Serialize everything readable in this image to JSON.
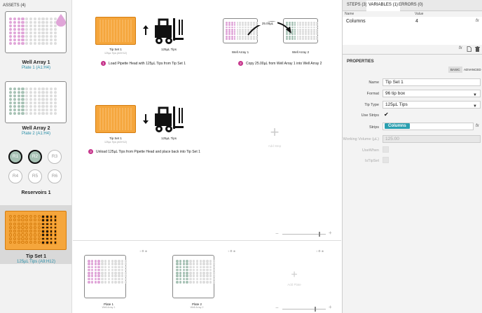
{
  "assets_panel": {
    "header": "ASSETS (4)",
    "assets": [
      {
        "name": "Well Array 1",
        "sub": "Plate 1 (A1:H4)"
      },
      {
        "name": "Well Array 2",
        "sub": "Plate 2 (A1:H4)"
      },
      {
        "name": "Reservoirs 1",
        "sub": ""
      },
      {
        "name": "Tip Set 1",
        "sub": "125µL Tips (A9:H12)"
      }
    ],
    "reservoirs": [
      "R1",
      "R2",
      "R3",
      "R4",
      "R5",
      "R6"
    ]
  },
  "workspace": {
    "steps": [
      {
        "number": "1",
        "text": "Load Pipette Head with 125µL Tips from Tip Set 1",
        "source_label": "Tip Set 1",
        "source_sub": "125µL Tips (A9:H12)",
        "target_label": "125µL Tips"
      },
      {
        "number": "2",
        "text": "Copy 25.00µL from Well Array 1 into Well Array 2",
        "source_label": "Well Array 1",
        "target_label": "Well Array 2",
        "arrow_label": "25.00µL"
      },
      {
        "number": "3",
        "text": "Unload 125µL Tips from Pipette Head and place back into Tip Set 1",
        "source_label": "Tip Set 1",
        "source_sub": "125µL Tips (A9:H12)",
        "target_label": "125µL Tips"
      }
    ],
    "add_step": "Add Step"
  },
  "deck": {
    "plates": [
      {
        "name": "Plate 1",
        "sub": "Well Array 1"
      },
      {
        "name": "Plate 2",
        "sub": "Well Array 2"
      }
    ],
    "add_plate": "Add Plate"
  },
  "right_panel": {
    "tabs": [
      "STEPS (3)",
      "VARIABLES (1)",
      "ERRORS (0)"
    ],
    "var_headers": {
      "name": "Name",
      "value": "Value"
    },
    "variables": [
      {
        "name": "Columns",
        "value": "4"
      }
    ],
    "properties_title": "PROPERTIES",
    "mode_buttons": [
      "BASIC",
      "ADVANCED"
    ],
    "properties": {
      "name_label": "Name",
      "name_value": "Tip Set 1",
      "format_label": "Format",
      "format_value": "96 tip box",
      "tiptype_label": "Tip Type",
      "tiptype_value": "125µL Tips",
      "usestrips_label": "Use Strips",
      "usestrips_check": "✔",
      "strips_label": "Strips",
      "strips_value": "Columns",
      "working_label": "Working Volume (µL)",
      "working_value": "125.00",
      "usewhen_label": "UseWhen",
      "ignore_label": "IsTipSet"
    },
    "fx_symbol": "fx"
  },
  "colors": {
    "pink": "#e0a5d8",
    "green": "#a7c2b5",
    "orange": "#f5a63c",
    "teal": "#2a9fb0",
    "magenta": "#c5328a"
  }
}
